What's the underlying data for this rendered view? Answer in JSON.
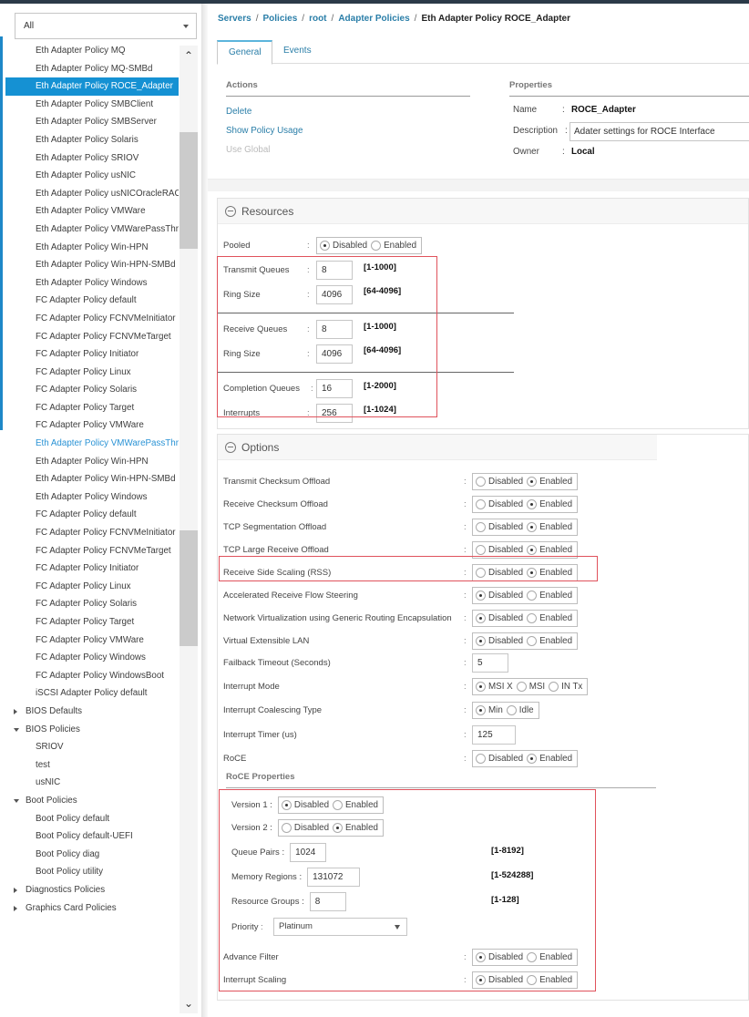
{
  "sidebar": {
    "filter": {
      "value": "All"
    },
    "items": [
      {
        "label": "Eth Adapter Policy MQ",
        "type": "leaf"
      },
      {
        "label": "Eth Adapter Policy MQ-SMBd",
        "type": "leaf"
      },
      {
        "label": "Eth Adapter Policy ROCE_Adapter",
        "type": "selected"
      },
      {
        "label": "Eth Adapter Policy SMBClient",
        "type": "leaf"
      },
      {
        "label": "Eth Adapter Policy SMBServer",
        "type": "leaf"
      },
      {
        "label": "Eth Adapter Policy Solaris",
        "type": "leaf"
      },
      {
        "label": "Eth Adapter Policy SRIOV",
        "type": "leaf"
      },
      {
        "label": "Eth Adapter Policy usNIC",
        "type": "leaf"
      },
      {
        "label": "Eth Adapter Policy usNICOracleRAC",
        "type": "leaf"
      },
      {
        "label": "Eth Adapter Policy VMWare",
        "type": "leaf"
      },
      {
        "label": "Eth Adapter Policy VMWarePassThru",
        "type": "leaf"
      },
      {
        "label": "Eth Adapter Policy Win-HPN",
        "type": "leaf"
      },
      {
        "label": "Eth Adapter Policy Win-HPN-SMBd",
        "type": "leaf"
      },
      {
        "label": "Eth Adapter Policy Windows",
        "type": "leaf"
      },
      {
        "label": "FC Adapter Policy default",
        "type": "leaf"
      },
      {
        "label": "FC Adapter Policy FCNVMeInitiator",
        "type": "leaf"
      },
      {
        "label": "FC Adapter Policy FCNVMeTarget",
        "type": "leaf"
      },
      {
        "label": "FC Adapter Policy Initiator",
        "type": "leaf"
      },
      {
        "label": "FC Adapter Policy Linux",
        "type": "leaf"
      },
      {
        "label": "FC Adapter Policy Solaris",
        "type": "leaf"
      },
      {
        "label": "FC Adapter Policy Target",
        "type": "leaf"
      },
      {
        "label": "FC Adapter Policy VMWare",
        "type": "leaf"
      },
      {
        "label": "Eth Adapter Policy VMWarePassThru",
        "type": "link"
      },
      {
        "label": "Eth Adapter Policy Win-HPN",
        "type": "leaf"
      },
      {
        "label": "Eth Adapter Policy Win-HPN-SMBd",
        "type": "leaf"
      },
      {
        "label": "Eth Adapter Policy Windows",
        "type": "leaf"
      },
      {
        "label": "FC Adapter Policy default",
        "type": "leaf"
      },
      {
        "label": "FC Adapter Policy FCNVMeInitiator",
        "type": "leaf"
      },
      {
        "label": "FC Adapter Policy FCNVMeTarget",
        "type": "leaf"
      },
      {
        "label": "FC Adapter Policy Initiator",
        "type": "leaf"
      },
      {
        "label": "FC Adapter Policy Linux",
        "type": "leaf"
      },
      {
        "label": "FC Adapter Policy Solaris",
        "type": "leaf"
      },
      {
        "label": "FC Adapter Policy Target",
        "type": "leaf"
      },
      {
        "label": "FC Adapter Policy VMWare",
        "type": "leaf"
      },
      {
        "label": "FC Adapter Policy Windows",
        "type": "leaf"
      },
      {
        "label": "FC Adapter Policy WindowsBoot",
        "type": "leaf"
      },
      {
        "label": "iSCSI Adapter Policy default",
        "type": "leaf"
      },
      {
        "label": "BIOS Defaults",
        "type": "collapsed"
      },
      {
        "label": "BIOS Policies",
        "type": "expanded"
      },
      {
        "label": "SRIOV",
        "type": "leaf"
      },
      {
        "label": "test",
        "type": "leaf"
      },
      {
        "label": "usNIC",
        "type": "leaf"
      },
      {
        "label": "Boot Policies",
        "type": "expanded"
      },
      {
        "label": "Boot Policy default",
        "type": "leaf"
      },
      {
        "label": "Boot Policy default-UEFI",
        "type": "leaf"
      },
      {
        "label": "Boot Policy diag",
        "type": "leaf"
      },
      {
        "label": "Boot Policy utility",
        "type": "leaf"
      },
      {
        "label": "Diagnostics Policies",
        "type": "collapsed"
      },
      {
        "label": "Graphics Card Policies",
        "type": "collapsed"
      }
    ]
  },
  "breadcrumb": {
    "items": [
      "Servers",
      "Policies",
      "root",
      "Adapter Policies"
    ],
    "separator": "/",
    "current": "Eth Adapter Policy ROCE_Adapter"
  },
  "tabs": {
    "general": "General",
    "events": "Events",
    "active": "General"
  },
  "actions": {
    "heading": "Actions",
    "delete": "Delete",
    "show_usage": "Show Policy Usage",
    "use_global": "Use Global"
  },
  "properties": {
    "heading": "Properties",
    "name_label": "Name",
    "name_value": "ROCE_Adapter",
    "description_label": "Description",
    "description_value": "Adater settings for ROCE Interface",
    "owner_label": "Owner",
    "owner_value": "Local",
    "colon": ":"
  },
  "resources": {
    "heading": "Resources",
    "pooled": {
      "label": "Pooled",
      "options": [
        "Disabled",
        "Enabled"
      ],
      "selected": "Disabled"
    },
    "transmit_queues": {
      "label": "Transmit Queues",
      "value": "8",
      "range": "[1-1000]"
    },
    "transmit_ring_size": {
      "label": "Ring Size",
      "value": "4096",
      "range": "[64-4096]"
    },
    "receive_queues": {
      "label": "Receive Queues",
      "value": "8",
      "range": "[1-1000]"
    },
    "receive_ring_size": {
      "label": "Ring Size",
      "value": "4096",
      "range": "[64-4096]"
    },
    "completion_queues": {
      "label": "Completion Queues",
      "value": "16",
      "range": "[1-2000]"
    },
    "interrupts": {
      "label": "Interrupts",
      "value": "256",
      "range": "[1-1024]"
    }
  },
  "options": {
    "heading": "Options",
    "rows": [
      {
        "label": "Transmit Checksum Offload",
        "options": [
          "Disabled",
          "Enabled"
        ],
        "selected": "Enabled"
      },
      {
        "label": "Receive Checksum Offload",
        "options": [
          "Disabled",
          "Enabled"
        ],
        "selected": "Enabled"
      },
      {
        "label": "TCP Segmentation Offload",
        "options": [
          "Disabled",
          "Enabled"
        ],
        "selected": "Enabled"
      },
      {
        "label": "TCP Large Receive Offload",
        "options": [
          "Disabled",
          "Enabled"
        ],
        "selected": "Enabled"
      },
      {
        "label": "Receive Side Scaling (RSS)",
        "options": [
          "Disabled",
          "Enabled"
        ],
        "selected": "Enabled"
      },
      {
        "label": "Accelerated Receive Flow Steering",
        "options": [
          "Disabled",
          "Enabled"
        ],
        "selected": "Disabled"
      },
      {
        "label": "Network Virtualization using Generic Routing Encapsulation",
        "options": [
          "Disabled",
          "Enabled"
        ],
        "selected": "Disabled"
      },
      {
        "label": "Virtual Extensible LAN",
        "options": [
          "Disabled",
          "Enabled"
        ],
        "selected": "Disabled"
      }
    ],
    "failback_timeout": {
      "label": "Failback Timeout (Seconds)",
      "value": "5"
    },
    "interrupt_mode": {
      "label": "Interrupt Mode",
      "options": [
        "MSI X",
        "MSI",
        "IN Tx"
      ],
      "selected": "MSI X"
    },
    "interrupt_coalescing": {
      "label": "Interrupt Coalescing Type",
      "options": [
        "Min",
        "Idle"
      ],
      "selected": "Min"
    },
    "interrupt_timer": {
      "label": "Interrupt Timer (us)",
      "value": "125"
    },
    "roce": {
      "label": "RoCE",
      "options": [
        "Disabled",
        "Enabled"
      ],
      "selected": "Enabled"
    }
  },
  "roce_properties": {
    "heading": "RoCE Properties",
    "version1": {
      "label": "Version 1 :",
      "options": [
        "Disabled",
        "Enabled"
      ],
      "selected": "Disabled"
    },
    "version2": {
      "label": "Version 2 :",
      "options": [
        "Disabled",
        "Enabled"
      ],
      "selected": "Enabled"
    },
    "queue_pairs": {
      "label": "Queue Pairs :",
      "value": "1024",
      "range": "[1-8192]"
    },
    "memory_regions": {
      "label": "Memory Regions :",
      "value": "131072",
      "range": "[1-524288]"
    },
    "resource_groups": {
      "label": "Resource Groups :",
      "value": "8",
      "range": "[1-128]"
    },
    "priority": {
      "label": "Priority",
      "value": "Platinum"
    },
    "advance_filter": {
      "label": "Advance Filter",
      "options": [
        "Disabled",
        "Enabled"
      ],
      "selected": "Disabled"
    },
    "interrupt_scaling": {
      "label": "Interrupt Scaling",
      "options": [
        "Disabled",
        "Enabled"
      ],
      "selected": "Disabled"
    }
  },
  "colors": {
    "accent": "#1591d3",
    "link": "#2a7ea8",
    "highlight_box": "#e0525c",
    "topbar": "#2b3a48"
  }
}
